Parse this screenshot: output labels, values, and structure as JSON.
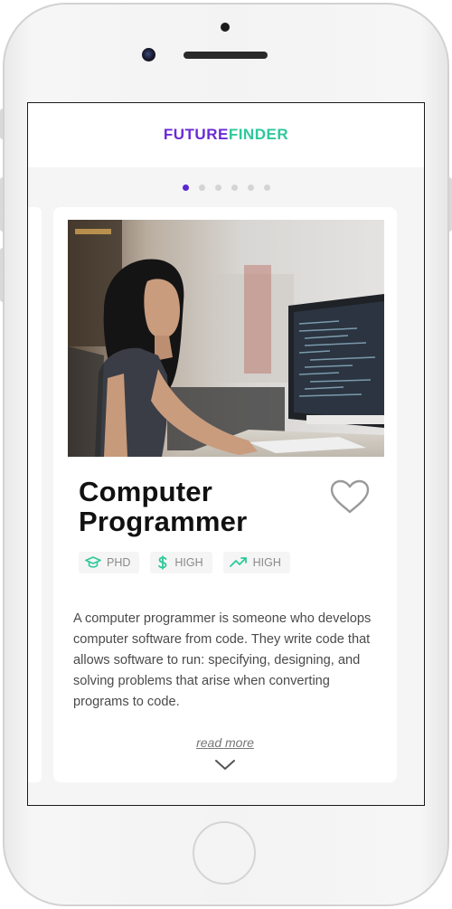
{
  "app": {
    "logo_part1": "FUTURE",
    "logo_part2": "FINDER",
    "brand_purple": "#6a2bd6",
    "brand_green": "#2ec99a"
  },
  "carousel": {
    "dot_count": 6,
    "active_index": 0
  },
  "career": {
    "title_line1": "Computer",
    "title_line2": "Programmer",
    "favorite_icon": "heart-outline-icon",
    "badges": [
      {
        "icon": "graduation-cap-icon",
        "label": "PHD"
      },
      {
        "icon": "dollar-icon",
        "label": "HIGH"
      },
      {
        "icon": "trending-up-icon",
        "label": "HIGH"
      }
    ],
    "description": "A computer programmer is someone who develops computer software from code. They write code that allows software to run: specifying, designing, and solving problems that arise when converting programs to code.",
    "read_more_label": "read more",
    "expand_icon": "chevron-down-icon"
  }
}
